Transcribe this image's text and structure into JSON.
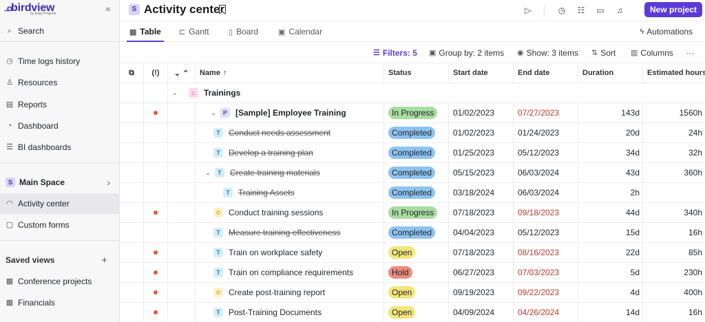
{
  "sidebar": {
    "logo": "birdview",
    "logo_sub": "by Easy Projects",
    "search_label": "Search",
    "nav": [
      {
        "label": "Time logs history",
        "icon": "stopwatch-icon"
      },
      {
        "label": "Resources",
        "icon": "person-icon"
      },
      {
        "label": "Reports",
        "icon": "report-icon"
      },
      {
        "label": "Dashboard",
        "icon": "gauge-icon"
      },
      {
        "label": "BI dashboards",
        "icon": "list-icon"
      }
    ],
    "space_badge": "S",
    "space_label": "Main Space",
    "activity_label": "Activity center",
    "forms_label": "Custom forms",
    "saved_views_label": "Saved views",
    "saved_views": [
      {
        "label": "Conference projects"
      },
      {
        "label": "Financials"
      }
    ]
  },
  "header": {
    "badge": "S",
    "title": "Activity center",
    "new_project_label": "New project"
  },
  "tabs": [
    {
      "label": "Table",
      "icon": "table-icon",
      "active": true
    },
    {
      "label": "Gantt",
      "icon": "gantt-icon"
    },
    {
      "label": "Board",
      "icon": "board-icon"
    },
    {
      "label": "Calendar",
      "icon": "calendar-icon"
    }
  ],
  "automations_label": "Automations",
  "toolbar": {
    "filters": "Filters: 5",
    "group_by": "Group by: 2 items",
    "show": "Show: 3 items",
    "sort": "Sort",
    "columns": "Columns"
  },
  "columns": {
    "priority": "(!)",
    "name": "Name",
    "status": "Status",
    "start": "Start date",
    "end": "End date",
    "duration": "Duration",
    "hours": "Estimated hours"
  },
  "status_colors": {
    "In Progress": "#a8dca0",
    "Completed": "#8ec3f0",
    "Open": "#f4e57a",
    "Hold": "#ec8a7e"
  },
  "rows": [
    {
      "group": true,
      "name": "Trainings",
      "type": "G"
    },
    {
      "dot": true,
      "caret": "v",
      "type": "P",
      "name": "[Sample] Employee Training",
      "bold": true,
      "status": "In Progress",
      "start": "01/02/2023",
      "end": "07/27/2023",
      "late": true,
      "duration": "143d",
      "hours": "1560h"
    },
    {
      "type": "T",
      "name": "Conduct needs assessment",
      "strike": true,
      "status": "Completed",
      "start": "01/02/2023",
      "end": "01/24/2023",
      "duration": "20d",
      "hours": "24h"
    },
    {
      "type": "T",
      "name": "Develop a training plan",
      "strike": true,
      "status": "Completed",
      "start": "01/25/2023",
      "end": "05/12/2023",
      "duration": "34d",
      "hours": "32h"
    },
    {
      "caret": "v",
      "type": "T",
      "name": "Create training materials",
      "strike": true,
      "status": "Completed",
      "start": "05/15/2023",
      "end": "06/03/2024",
      "duration": "43d",
      "hours": "360h"
    },
    {
      "type": "T",
      "name": "Training Assets",
      "strike": true,
      "indent": 2,
      "status": "Completed",
      "start": "03/18/2024",
      "end": "06/03/2024",
      "duration": "2h",
      "hours": ""
    },
    {
      "dot": true,
      "type": "M",
      "name": "Conduct training sessions",
      "status": "In Progress",
      "start": "07/18/2023",
      "end": "09/18/2023",
      "late": true,
      "duration": "44d",
      "hours": "340h"
    },
    {
      "type": "T",
      "name": "Measure training effectiveness",
      "strike": true,
      "status": "Completed",
      "start": "04/04/2023",
      "end": "05/12/2023",
      "duration": "15d",
      "hours": "16h"
    },
    {
      "dot": true,
      "type": "T",
      "name": "Train on workplace safety",
      "status": "Open",
      "start": "07/18/2023",
      "end": "08/16/2023",
      "late": true,
      "duration": "22d",
      "hours": "85h"
    },
    {
      "dot": true,
      "type": "T",
      "name": "Train on compliance requirements",
      "status": "Hold",
      "start": "06/27/2023",
      "end": "07/03/2023",
      "late": true,
      "duration": "5d",
      "hours": "230h"
    },
    {
      "dot": true,
      "type": "M",
      "name": "Create post-training report",
      "status": "Open",
      "start": "09/19/2023",
      "end": "09/22/2023",
      "late": true,
      "duration": "4d",
      "hours": "400h"
    },
    {
      "dot": true,
      "type": "T",
      "name": "Post-Training Documents",
      "status": "Open",
      "start": "04/09/2024",
      "end": "04/26/2024",
      "late": true,
      "duration": "14d",
      "hours": "16h"
    }
  ]
}
